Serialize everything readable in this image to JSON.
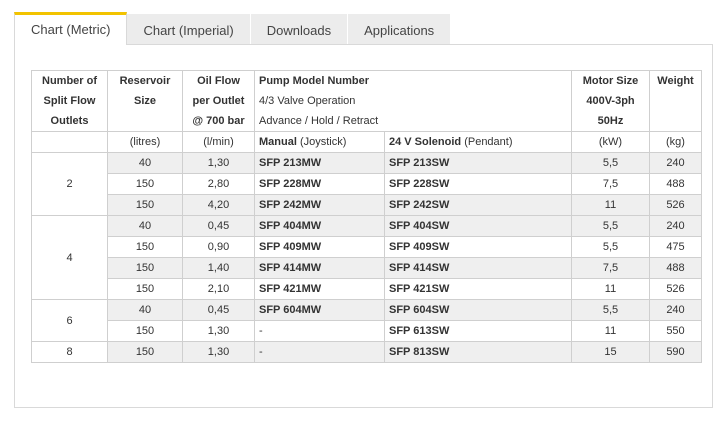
{
  "tabs": [
    {
      "label": "Chart (Metric)",
      "active": true
    },
    {
      "label": "Chart (Imperial)",
      "active": false
    },
    {
      "label": "Downloads",
      "active": false
    },
    {
      "label": "Applications",
      "active": false
    }
  ],
  "table": {
    "headers": {
      "outlets": [
        "Number of",
        "Split Flow",
        "Outlets"
      ],
      "reservoir": [
        "Reservoir",
        "Size"
      ],
      "oilflow": [
        "Oil Flow",
        "per Outlet",
        "@ 700 bar"
      ],
      "pump": [
        "Pump Model Number",
        "4/3 Valve Operation",
        "Advance / Hold / Retract"
      ],
      "motor": [
        "Motor Size",
        "400V-3ph",
        "50Hz"
      ],
      "weight": "Weight"
    },
    "units": {
      "reservoir": "(litres)",
      "oilflow": "(l/min)",
      "manual_bold": "Manual",
      "manual_rest": " (Joystick)",
      "solenoid_bold": "24 V Solenoid",
      "solenoid_rest": " (Pendant)",
      "motor": "(kW)",
      "weight": "(kg)"
    },
    "groups": [
      {
        "outlets": "2",
        "rows": [
          {
            "res": "40",
            "flow": "1,30",
            "manual": "SFP 213MW",
            "sol": "SFP 213SW",
            "motor": "5,5",
            "weight": "240"
          },
          {
            "res": "150",
            "flow": "2,80",
            "manual": "SFP 228MW",
            "sol": "SFP 228SW",
            "motor": "7,5",
            "weight": "488"
          },
          {
            "res": "150",
            "flow": "4,20",
            "manual": "SFP 242MW",
            "sol": "SFP 242SW",
            "motor": "11",
            "weight": "526"
          }
        ]
      },
      {
        "outlets": "4",
        "rows": [
          {
            "res": "40",
            "flow": "0,45",
            "manual": "SFP 404MW",
            "sol": "SFP 404SW",
            "motor": "5,5",
            "weight": "240"
          },
          {
            "res": "150",
            "flow": "0,90",
            "manual": "SFP 409MW",
            "sol": "SFP 409SW",
            "motor": "5,5",
            "weight": "475"
          },
          {
            "res": "150",
            "flow": "1,40",
            "manual": "SFP 414MW",
            "sol": "SFP 414SW",
            "motor": "7,5",
            "weight": "488"
          },
          {
            "res": "150",
            "flow": "2,10",
            "manual": "SFP 421MW",
            "sol": "SFP 421SW",
            "motor": "11",
            "weight": "526"
          }
        ]
      },
      {
        "outlets": "6",
        "rows": [
          {
            "res": "40",
            "flow": "0,45",
            "manual": "SFP 604MW",
            "sol": "SFP 604SW",
            "motor": "5,5",
            "weight": "240"
          },
          {
            "res": "150",
            "flow": "1,30",
            "manual": "-",
            "sol": "SFP 613SW",
            "motor": "11",
            "weight": "550"
          }
        ]
      },
      {
        "outlets": "8",
        "rows": [
          {
            "res": "150",
            "flow": "1,30",
            "manual": "-",
            "sol": "SFP 813SW",
            "motor": "15",
            "weight": "590"
          }
        ]
      }
    ]
  }
}
